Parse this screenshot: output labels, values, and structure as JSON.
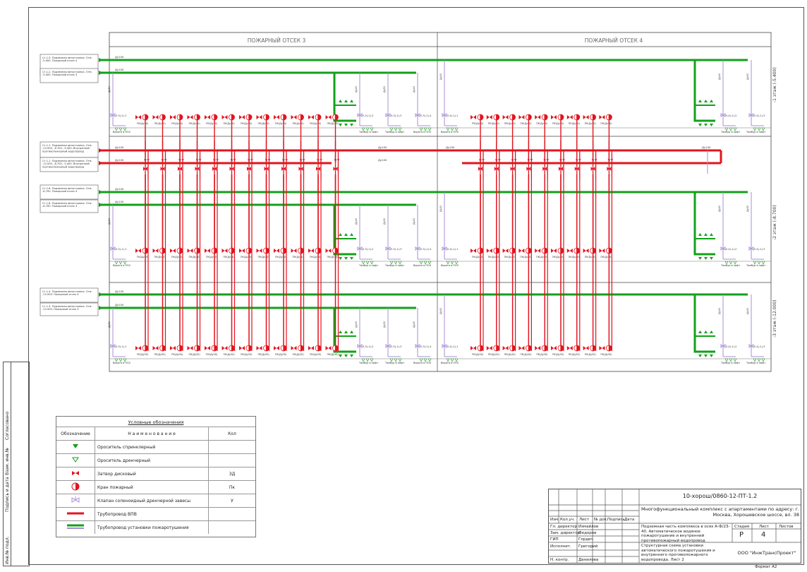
{
  "headers": {
    "zone3": "ПОЖАРНЫЙ ОТСЕК 3",
    "zone4": "ПОЖАРНЫЙ ОТСЕК 4"
  },
  "floor_labels": [
    "-1 этаж (-5.400)",
    "-2 этаж (-8.700)",
    "-3 этаж (-12.000)"
  ],
  "left_labels": [
    {
      "text": "Ст.1.3. Подземная автостоянка. Отм. -5.400. Пожарный отсек 4"
    },
    {
      "text": "Ст.1.2. Подземная автостоянка. Отм. -5.400. Пожарный отсек 3"
    },
    {
      "text": "Ст.1.1. Подземная автостоянка. Отм. -12.000, -8.700, -5.400. Внутренний противопожарный водопровод"
    },
    {
      "text": "Ст.1.1. Подземная автостоянка. Отм. -12.000, -8.700, -5.400. Внутренний противопожарный водопровод"
    },
    {
      "text": "Ст.1.8. Подземная автостоянка. Отм. -8.700. Пожарный отсек 4"
    },
    {
      "text": "Ст.1.8. Подземная автостоянка. Отм. -8.700. Пожарный отсек 3"
    },
    {
      "text": "Ст.1.4. Подземная автостоянка. Отм. -12.000. Пожарный отсек 4"
    },
    {
      "text": "Ст.1.3. Подземная автостоянка. Отм. -12.000. Пожарный отсек 3"
    }
  ],
  "pipe_labels": {
    "green": "Ду100",
    "red": "Ду100",
    "riser": "Ду50",
    "branch": "Ду40",
    "small": "Ду100",
    "red_branch": "Ду32"
  },
  "valve_label": "ПК(Ду50)",
  "zone3_valve_labels": [
    "У-3(-1)-1",
    "У-3(-1)-2",
    "У-3(-1)-3",
    "У-3(-1)-4"
  ],
  "zone4_valve_labels": [
    "У-4(-1)-1",
    "У-4(-1)-2",
    "У-4(-1)-3"
  ],
  "bottom_captions": {
    "gate3": "Ворота в ПО2",
    "tambur": "Тамбур в лифт",
    "gate4": "Ворота в ПО4",
    "gate5": "Ворота в ПО5"
  },
  "legend": {
    "title": "Условные обозначения",
    "cols": [
      "Обозначение",
      "Н а и м е н о в а н и е",
      "Кол"
    ],
    "rows": [
      {
        "name": "Ороситель спринклерный",
        "qty": ""
      },
      {
        "name": "Ороситель дренчерный",
        "qty": ""
      },
      {
        "name": "Затвор дисковый",
        "qty": "ЗД"
      },
      {
        "name": "Кран пожарный",
        "qty": "Пк"
      },
      {
        "name": "Клапан соленоидный дренчерной завесы",
        "qty": "У"
      },
      {
        "name": "Трубопровод ВПВ",
        "qty": ""
      },
      {
        "name": "Трубопровод установки пожаротушения",
        "qty": ""
      }
    ]
  },
  "title_block": {
    "code": "10-хорош/0860-12-ПТ-1.2",
    "project": "Многофункциональный комплекс с апартаментами по адресу: г. Москва, Хорошевское шоссе, вл. 38",
    "part": "Подземная часть комплекса в осях А-Ф/23-40. Автоматическое водяное пожаротушение и внутренний противопожарный водопровод",
    "sheet_title": "Структурная схема установки автоматического пожаротушения и внутреннего противопожарного водопровода. Лист 2",
    "company": "ООО \"ИнжТрансПроект\"",
    "stage_h": "Стадия",
    "sheet_h": "Лист",
    "sheets_h": "Листов",
    "stage": "Р",
    "sheet": "4",
    "cols": [
      "Изм.",
      "Кол.уч.",
      "Лист",
      "№ док.",
      "Подпись",
      "Дата"
    ],
    "roles": [
      {
        "role": "Гл. директор",
        "name": "Измайлов"
      },
      {
        "role": "Зам. директор",
        "name": "Федоров"
      },
      {
        "role": "ГИП",
        "name": "Гордич"
      },
      {
        "role": "Исполнит.",
        "name": "Григорий"
      },
      {
        "role": "Н. контр.",
        "name": "Данилова"
      }
    ],
    "format": "Формат А2"
  },
  "side_stamp": [
    "Инв.№ подл.",
    "Подпись и дата",
    "Взам. инв.№",
    "Согласовано"
  ],
  "colors": {
    "green": "#12a11a",
    "red": "#e2141e",
    "violet": "#a78fd6",
    "frame": "#555555"
  }
}
